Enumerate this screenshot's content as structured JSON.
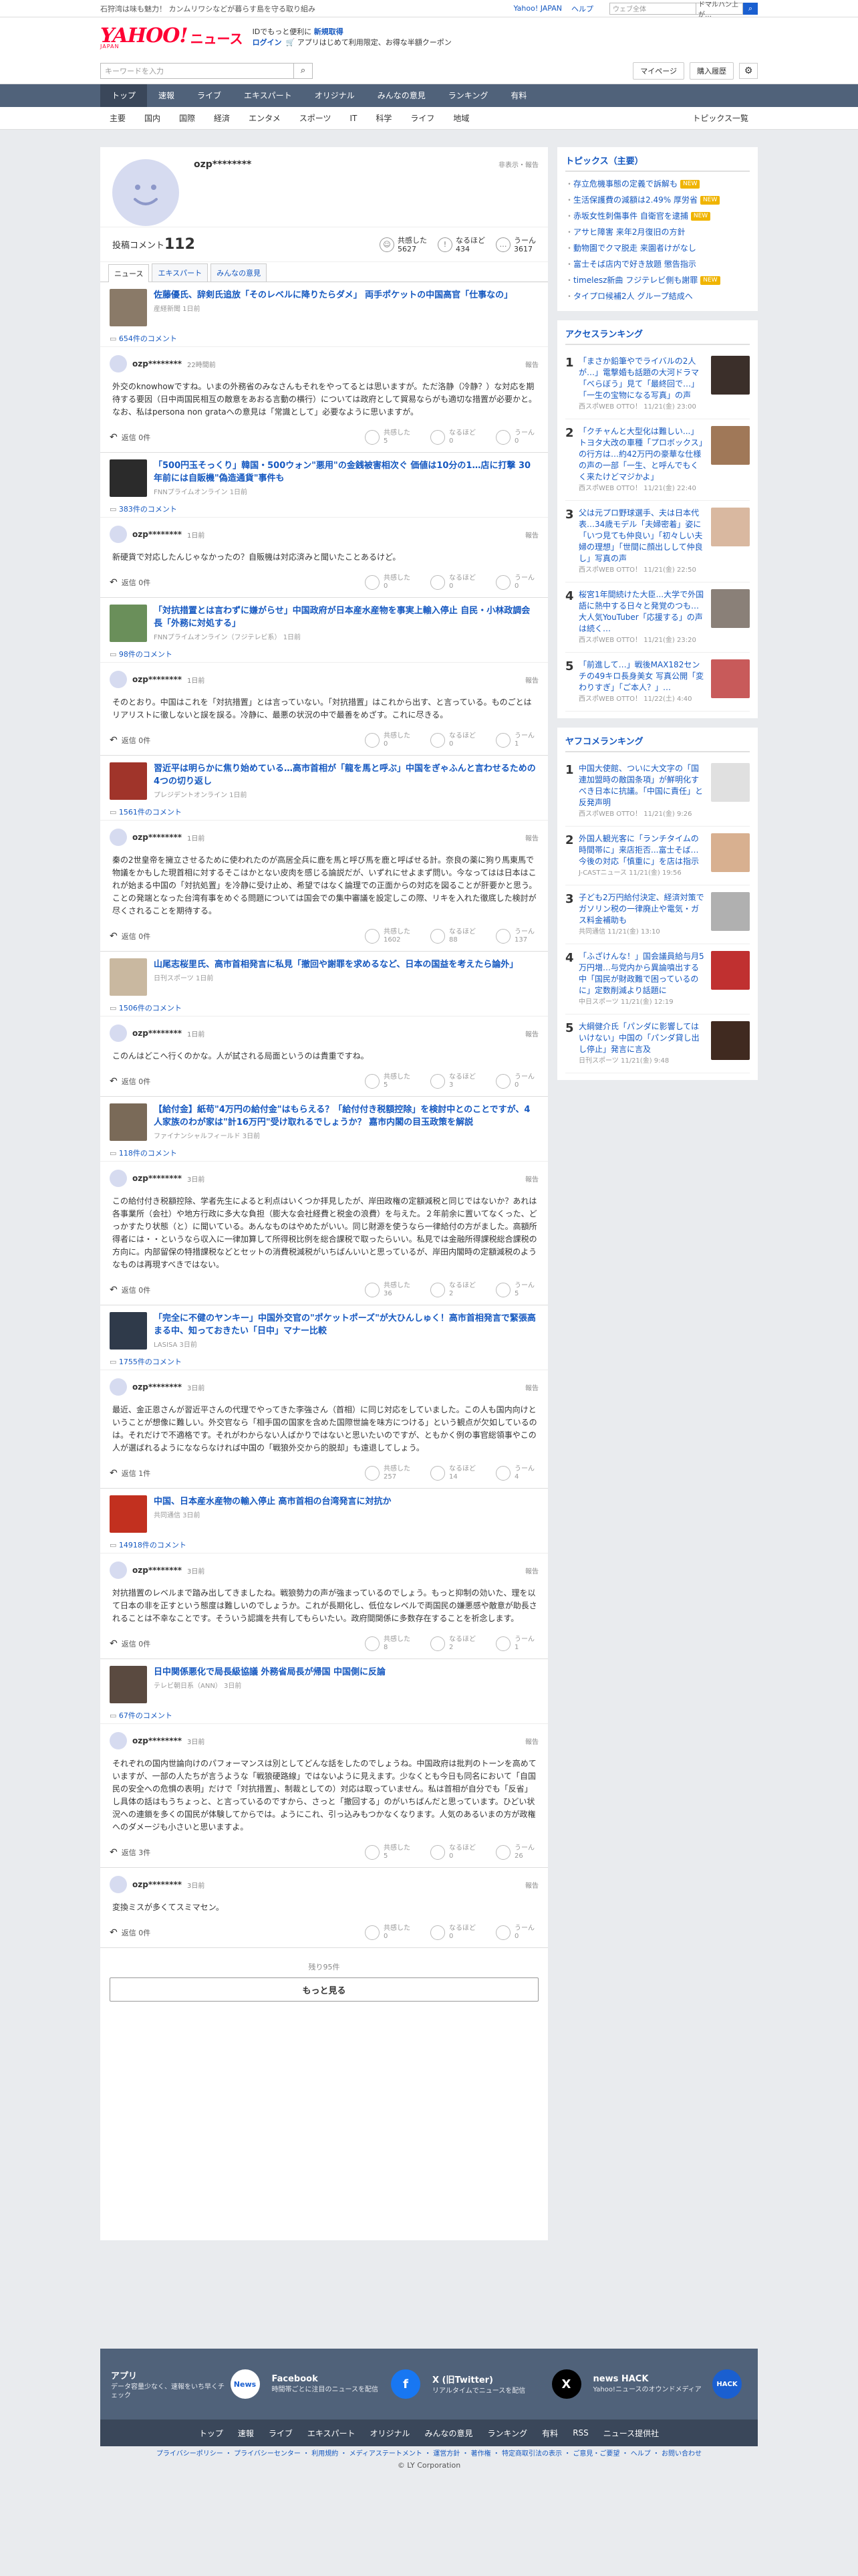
{
  "top_bar": {
    "promo": "石狩湾は味も魅力！ カンムリワシなどが暮らす島を守る取り組み",
    "links": [
      "Yahoo! JAPAN",
      "ヘルプ"
    ],
    "search_placeholder": "ウェブ全体",
    "search_select": "ドマルハン上が…"
  },
  "header": {
    "logo": "YAHOO!",
    "logo_sub": "JAPAN",
    "logo_news": "ニュース",
    "msg_line1_a": "IDでもっと便利に",
    "msg_line1_b": "新規取得",
    "msg_line2_login": "ログイン",
    "msg_line2_text": "🛒 アプリはじめて利用限定、お得な半額クーポン"
  },
  "search_bar": {
    "placeholder": "キーワードを入力",
    "mypage": "マイページ",
    "history": "購入履歴"
  },
  "global_nav": [
    "トップ",
    "速報",
    "ライブ",
    "エキスパート",
    "オリジナル",
    "みんなの意見",
    "ランキング",
    "有料"
  ],
  "sub_nav": [
    "主要",
    "国内",
    "国際",
    "経済",
    "エンタメ",
    "スポーツ",
    "IT",
    "科学",
    "ライフ",
    "地域"
  ],
  "sub_nav_right": "トピックス一覧",
  "profile": {
    "name": "ozp********",
    "report": "非表示・報告",
    "comments_label": "投稿コメント",
    "comments_count": "112",
    "reactions": [
      {
        "label": "共感した",
        "value": "5627"
      },
      {
        "label": "なるほど",
        "value": "434"
      },
      {
        "label": "うーん",
        "value": "3617"
      }
    ]
  },
  "tabs": [
    "ニュース",
    "エキスパート",
    "みんなの意見"
  ],
  "comments": [
    {
      "title": "佐藤優氏、辞剣氏追放「そのレベルに降りたらダメ」 両手ポケットの中国高官「仕事なの」",
      "source": "産経新聞 1日前",
      "count": "654件のコメント",
      "user": "ozp********",
      "time": "22時間前",
      "report": "報告",
      "body": "外交のknowhowですね。いまの外務省のみなさんもそれをやってるとは思いますが。ただ洛静（冷静？）な対応を期待する要因（日中両国民相互の敵意をあおる言動の横行）については政府として貿易ならがも適切な措置が必要かと。なお、私はpersona non grataへの意見は「常識として」必要なように思いますが。",
      "replies": "返信 0件",
      "r1": "5",
      "r2": "0",
      "r3": "0"
    },
    {
      "title": "「500円玉そっくり」韓国・500ウォン\"悪用\"の金銭被害相次ぐ 価値は10分の1…店に打撃 30年前には自販機\"偽造通貨\"事件も",
      "source": "FNNプライムオンライン 1日前",
      "count": "383件のコメント",
      "user": "ozp********",
      "time": "1日前",
      "report": "報告",
      "body": "新硬貨で対応したんじゃなかったの？自販機は対応済みと聞いたことあるけど。",
      "replies": "返信 0件",
      "r1": "0",
      "r2": "0",
      "r3": "0"
    },
    {
      "title": "「対抗措置とは言わずに嫌がらせ」中国政府が日本産水産物を事実上輸入停止 自民・小林政調会長「外務に対処する」",
      "source": "FNNプライムオンライン（フジテレビ系） 1日前",
      "count": "98件のコメント",
      "user": "ozp********",
      "time": "1日前",
      "report": "報告",
      "body": "そのとおり。中国はこれを「対抗措置」とは言っていない。「対抗措置」はこれから出す、と言っている。ものごとはリアリストに徹しないと誤を誤る。冷静に、最悪の状況の中で最善をめざす。これに尽きる。",
      "replies": "返信 0件",
      "r1": "0",
      "r2": "0",
      "r3": "1"
    },
    {
      "title": "習近平は明らかに焦り始めている…高市首相が「龍を馬と呼ぶ」中国をぎゃふんと言わせるための4つの切り返し",
      "source": "プレジデントオンライン 1日前",
      "count": "1561件のコメント",
      "user": "ozp********",
      "time": "1日前",
      "report": "報告",
      "body": "秦の2世皇帝を擁立させるために使われたのが高居全兵に鹿を馬と呼び馬を鹿と呼ばせる計。奈良の薬に狗り馬東馬で物議をかもした現首相に対するそこはかとない皮肉を感じる論説だが、いずれにせよまず問い。今なってはは日本はこれが始まる中国の「対抗処置」を冷静に受け止め、希望ではなく論理での正面からの対応を図ることが肝要かと思う。ことの発端となった台湾有事をめぐる問題については国会での集中審議を設定しこの際、リキを入れた徹底した検討が尽くされることを期待する。",
      "replies": "返信 0件",
      "r1": "1602",
      "r2": "88",
      "r3": "137"
    },
    {
      "title": "山尾志桜里氏、高市首相発言に私見「撤回や謝罪を求めるなど、日本の国益を考えたら論外」",
      "source": "日刊スポーツ 1日前",
      "count": "1506件のコメント",
      "user": "ozp********",
      "time": "1日前",
      "report": "報告",
      "body": "このんはどこへ行くのかな。人が試される局面というのは貴重ですね。",
      "replies": "返信 0件",
      "r1": "5",
      "r2": "3",
      "r3": "0"
    },
    {
      "title": "【給付金】紙苟\"4万円の給付金\"はもらえる？「給付付き税額控除」を検討中とのことですが、4人家族のわが家は\"計16万円\"受け取れるでしょうか？ 嘉市内閣の目玉政策を解説",
      "source": "ファイナンシャルフィールド 3日前",
      "count": "118件のコメント",
      "user": "ozp********",
      "time": "3日前",
      "report": "報告",
      "body": "この給付付き税額控除、学者先生によると利点はいくつか拝見したが、岸田政権の定額減税と同じではないか？あれは各事業所（会社）や地方行政に多大な負担（膨大な会社経費と税金の浪費）を与えた。２年前余に置いてなくった、どっかすたり状態（と）に聞いている。あんなものはやめたがいい。同じ財源を使うなら一律給付の方がました。高額所得者には・・というなら収入に一律加算して所得税比例を総合課税で取ったらいい。私見では金融所得課税総合課税の方向に。内部留保の特措課税などとセットの消費税減税がいちばんいいと思っているが、岸田内閣時の定額減税のようなものは再現すべきではない。",
      "replies": "返信 0件",
      "r1": "36",
      "r2": "2",
      "r3": "5"
    },
    {
      "title": "「完全に不健のヤンキー」中国外交官の\"ポケットポーズ\"が大ひんしゅく！高市首相発言で緊張高まる中、知っておきたい「日中」マナー比較",
      "source": "LASISA 3日前",
      "count": "1755件のコメント",
      "user": "ozp********",
      "time": "3日前",
      "report": "報告",
      "body": "最近、金正恩さんが習近平さんの代理でやってきた李強さん（首相）に同じ対応をしていました。この人も国内向けということが想像に難しい。外交官なら「相手国の国家を含めた国際世論を味方につける」という観点が欠如しているのは。それだけで不適格です。それがわからない人ばかりではないと思いたいのですが、ともかく例の事官総領事やこの人が選ばれるようになならなければ中国の「戦狼外交から的脱却」も遠退してしょう。",
      "replies": "返信 1件",
      "r1": "257",
      "r2": "14",
      "r3": "4"
    },
    {
      "title": "中国、日本産水産物の輸入停止 高市首相の台湾発言に対抗か",
      "source": "共同通信 3日前",
      "count": "14918件のコメント",
      "user": "ozp********",
      "time": "3日前",
      "report": "報告",
      "body": "対抗措置のレベルまで踏み出してきましたね。戦狼勢力の声が強まっているのでしょう。もっと抑制の効いた、理を以て日本の非を正すという態度は難しいのでしょうか。これが長期化し、低位なレベルで両国民の嫌悪感や敵意が助長されることは不幸なことです。そういう認識を共有してもらいたい。政府間関係に多数存在することを祈念します。",
      "replies": "返信 0件",
      "r1": "8",
      "r2": "2",
      "r3": "1"
    },
    {
      "title": "日中関係悪化で局長級協議 外務省局長が帰国 中国側に反論",
      "source": "テレビ朝日系（ANN） 3日前",
      "count": "67件のコメント",
      "user": "ozp********",
      "time": "3日前",
      "report": "報告",
      "body": "それぞれの国内世論向けのパフォーマンスは別としてどんな話をしたのでしょうね。中国政府は批判のトーンを高めていますが、一部の人たちが言うような「戦狼硬路線」ではないように見えます。少なくとも今日も同名において「自国民の安全への危惧の表明」だけで「対抗措置」、制裁としての）対応は取っていません。私は首相が自分でも「反省」し具体の話はもうちょっと、と言っているのですから、さっと「撤回する」のがいちばんだと思っています。ひどい状況への連鎖を多くの国民が体験してからでは。ようにこれ、引っ込みもつかなくなります。人気のあるいまの方が政権へのダメージも小さいと思いますよ。",
      "replies": "返信 3件",
      "r1": "5",
      "r2": "0",
      "r3": "26"
    },
    {
      "title": "",
      "source": "",
      "count": "",
      "user": "ozp********",
      "time": "3日前",
      "report": "報告",
      "body": "変換ミスが多くてスミマセン。",
      "replies": "返信 0件",
      "r1": "0",
      "r2": "0",
      "r3": "0"
    }
  ],
  "reaction_labels": {
    "r1": "共感した",
    "r2": "なるほど",
    "r3": "うーん"
  },
  "more": {
    "remaining": "残り95件",
    "button": "もっと見る"
  },
  "sidebar": {
    "topics_title": "トピックス（主要）",
    "topics": [
      {
        "text": "存立危機事態の定義で訴解も",
        "new": "NEW"
      },
      {
        "text": "生活保護費の減額は2.49% 厚労省",
        "new": "NEW"
      },
      {
        "text": "赤坂女性刺傷事件 自衛官を逮捕",
        "new": "NEW"
      },
      {
        "text": "アサヒ障害 来年2月復旧の方針",
        "new": ""
      },
      {
        "text": "動物園でクマ脱走 来園者けがなし",
        "new": ""
      },
      {
        "text": "富士そば店内で好き放題 懲告指示",
        "new": ""
      },
      {
        "text": "timelesz新曲 フジテレビ側も謝罪",
        "new": "NEW"
      },
      {
        "text": "タイプロ候補2人 グループ結成へ",
        "new": ""
      }
    ],
    "access_title": "アクセスランキング",
    "access": [
      {
        "n": "1",
        "t": "「まさか鉛筆やでライバルの2人が…」電撃婚も話題の大河ドラマ「べらぼう」見て「最終回で…」「一生の宝物になる写真」の声",
        "s": "西スポWEB OTTO！ 11/21(金) 23:00"
      },
      {
        "n": "2",
        "t": "「クチャんと大型化は難しい...」トヨタ大改の車種「プロボックス」の行方は…約42万円の豪華な仕様の声の一部「一生、と呼んでもくく来たけどマジかよ」",
        "s": "西スポWEB OTTO！ 11/21(金) 22:40"
      },
      {
        "n": "3",
        "t": "父は元プロ野球選手、夫は日本代表…34歳モデル「夫婦密着」姿に「いつ見ても仲良い」「初々しい夫婦の理想」「世間に顔出しして仲良し」写真の声",
        "s": "西スポWEB OTTO！ 11/21(金) 22:50"
      },
      {
        "n": "4",
        "t": "桜宮1年間続けた大臣...大学で外国語に熱中する日々と発覚のつも…大人気YouTuber「応援する」の声は続く…",
        "s": "西スポWEB OTTO！ 11/21(金) 23:20"
      },
      {
        "n": "5",
        "t": "「前進して…」戦後MAX182センチの49キロ長身美女 写真公開「変わりすぎ」「ご本人？」…",
        "s": "西スポWEB OTTO！ 11/22(土) 4:40"
      }
    ],
    "yahoo_title": "ヤフコメランキング",
    "yahoo": [
      {
        "n": "1",
        "t": "中国大使館、ついに大文字の「国連加盟時の敵国条項」が鮮明化すべき日本に抗議。「中国に責任」と反発声明",
        "s": "西スポWEB OTTO！ 11/21(金) 9:26"
      },
      {
        "n": "2",
        "t": "外国人観光客に「ランチタイムの時間帯に」来店拒否...富士そば…今後の対応「慎重に」を店は指示",
        "s": "J-CASTニュース 11/21(金) 19:56"
      },
      {
        "n": "3",
        "t": "子ども2万円給付決定、経済対策でガソリン税の一律廃止や電気・ガス料金補助も",
        "s": "共同通信 11/21(金) 13:10"
      },
      {
        "n": "4",
        "t": "「ふざけんな！」国会議員給与月5万円増…与党内から異論噴出する中「国民が財政難で困っているのに」定数削減より話題に",
        "s": "中日スポーツ 11/21(金) 12:19"
      },
      {
        "n": "5",
        "t": "大綱健介氏「パンダに影響してはいけない」中国の「パンダ貸し出し停止」発言に言及",
        "s": "日刊スポーツ 11/21(金) 9:48"
      }
    ]
  },
  "apps": [
    {
      "h": "アプリ",
      "d": "データ容量少なく、速報をいち早くチェック",
      "icon": "News"
    },
    {
      "h": "Facebook",
      "d": "時間帯ごとに注目のニュースを配信",
      "icon": "f"
    },
    {
      "h": "X (旧Twitter)",
      "d": "リアルタイムでニュースを配信",
      "icon": "X"
    },
    {
      "h": "news HACK",
      "d": "Yahoo!ニュースのオウンドメディア",
      "icon": "HACK"
    }
  ],
  "footer_nav": [
    "トップ",
    "速報",
    "ライブ",
    "エキスパート",
    "オリジナル",
    "みんなの意見",
    "ランキング",
    "有料",
    "RSS",
    "ニュース提供社"
  ],
  "footer_links": "プライバシーポリシー ・ プライバシーセンター ・ 利用規約 ・ メディアステートメント ・ 運営方針 ・ 著作権 ・ 特定商取引法の表示 ・ ご意見・ご要望 ・ ヘルプ ・ お問い合わせ",
  "copyright": "© LY Corporation",
  "colors": {
    "accent": "#1558c0",
    "brand": "#ff0033",
    "nav": "#50627a"
  }
}
